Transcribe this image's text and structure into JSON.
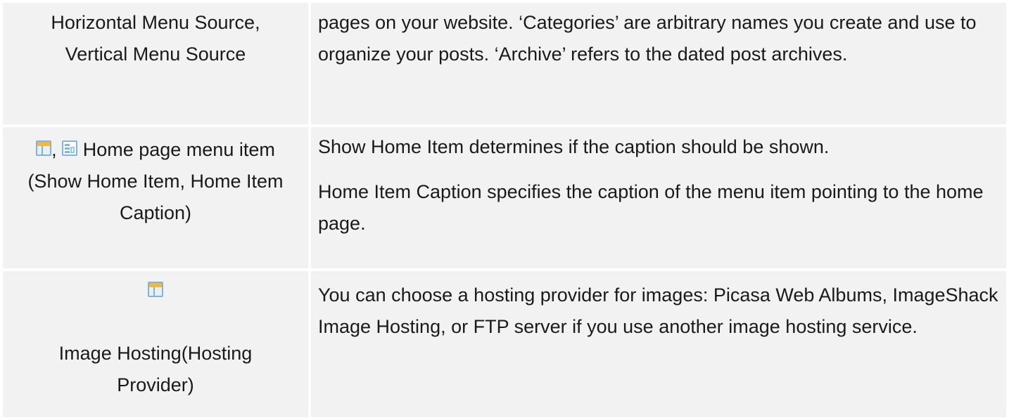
{
  "rows": [
    {
      "left_lines": [
        "Horizontal Menu Source,",
        "Vertical Menu Source"
      ],
      "right_paragraphs": [
        "pages on your website.  ‘Categories’ are arbitrary names you create and use to organize your posts.  ‘Archive’ refers to the dated post archives."
      ]
    },
    {
      "left_icons": [
        "horizontal-menu-icon",
        "vertical-menu-icon"
      ],
      "left_icon_separator": ",",
      "left_text": "Home page menu item (Show Home Item, Home Item Caption)",
      "right_paragraphs": [
        "Show Home Item determines if the caption should be shown.",
        "Home Item Caption specifies the caption of the menu item pointing to the home page."
      ]
    },
    {
      "left_icons": [
        "horizontal-menu-icon"
      ],
      "left_text": "Image Hosting(Hosting Provider)",
      "right_paragraphs": [
        "You can choose a hosting provider for images: Picasa Web Albums, ImageShack Image Hosting, or FTP server if you use another image hosting service."
      ]
    }
  ]
}
